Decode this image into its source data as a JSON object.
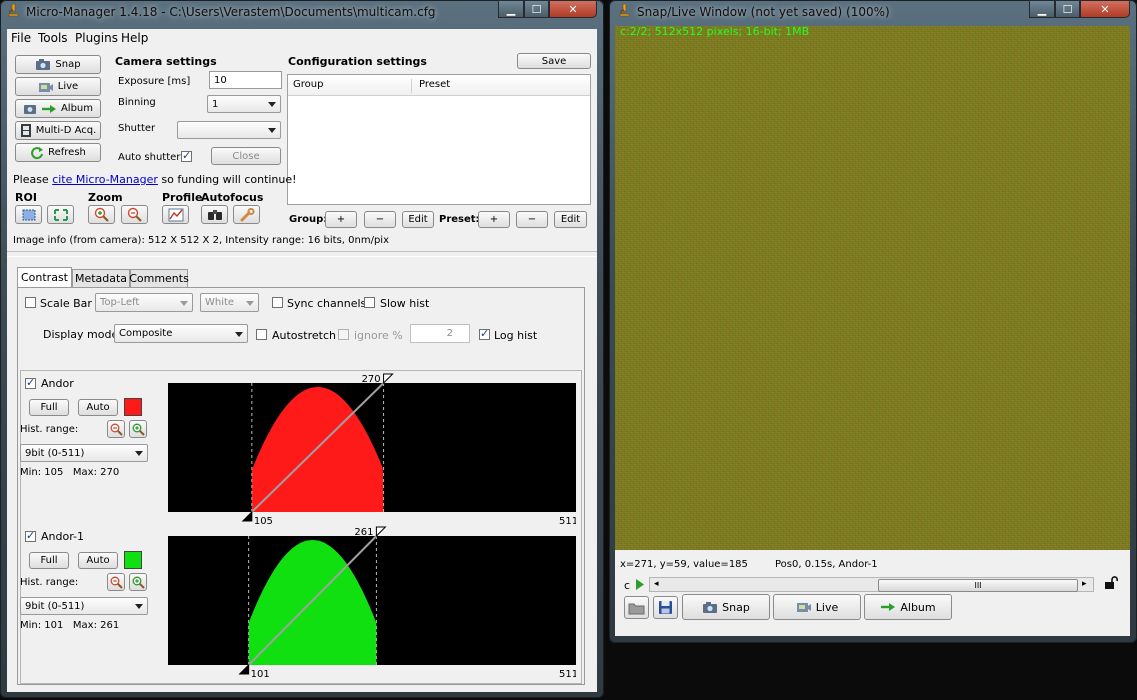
{
  "mm_window": {
    "title": "Micro-Manager 1.4.18 - C:\\Users\\Verastem\\Documents\\multicam.cfg",
    "menu": [
      "File",
      "Tools",
      "Plugins",
      "Help"
    ],
    "buttons": {
      "snap": "Snap",
      "live": "Live",
      "album": "Album",
      "multid": "Multi-D Acq.",
      "refresh": "Refresh"
    },
    "camera": {
      "heading": "Camera settings",
      "exposure_label": "Exposure [ms]",
      "exposure_value": "10",
      "binning_label": "Binning",
      "binning_value": "1",
      "shutter_label": "Shutter",
      "shutter_value": "",
      "auto_shutter_label": "Auto shutter",
      "close_label": "Close"
    },
    "config": {
      "heading": "Configuration settings",
      "save": "Save",
      "col_group": "Group",
      "col_preset": "Preset",
      "group_label": "Group:",
      "preset_label": "Preset:",
      "plus": "+",
      "minus": "−",
      "edit": "Edit"
    },
    "cite": {
      "pre": "Please",
      "link": "cite Micro-Manager",
      "post": "so funding will continue!"
    },
    "tool_headings": {
      "roi": "ROI",
      "zoom": "Zoom",
      "profile": "Profile",
      "autofocus": "Autofocus"
    },
    "image_info": "Image info (from camera): 512 X 512 X 2, Intensity range: 16 bits, 0nm/pix",
    "tabs": [
      "Contrast",
      "Metadata",
      "Comments"
    ],
    "contrast": {
      "scale_bar_label": "Scale Bar",
      "position_value": "Top-Left",
      "color_value": "White",
      "sync_channels": "Sync channels",
      "slow_hist": "Slow hist",
      "display_mode_label": "Display mode:",
      "display_mode_value": "Composite",
      "autostretch": "Autostretch",
      "ignore_label": "ignore %",
      "ignore_value": "2",
      "log_hist": "Log hist"
    },
    "channels": [
      {
        "name": "Andor",
        "color": "#ff1a1a",
        "full": "Full",
        "auto": "Auto",
        "hist_range_label": "Hist. range:",
        "bit_depth": "9bit (0-511)",
        "min_max": "Min: 105   Max: 270",
        "min": "105",
        "max": "270",
        "range_max": "511",
        "hist_range_min": 0,
        "hist_range_max": 511
      },
      {
        "name": "Andor-1",
        "color": "#10e010",
        "full": "Full",
        "auto": "Auto",
        "hist_range_label": "Hist. range:",
        "bit_depth": "9bit (0-511)",
        "min_max": "Min: 101   Max: 261",
        "min": "101",
        "max": "261",
        "range_max": "511",
        "hist_range_min": 0,
        "hist_range_max": 511
      }
    ]
  },
  "live_window": {
    "title": "Snap/Live Window (not yet saved) (100%)",
    "overlay": "c:2/2; 512x512 pixels; 16-bit; 1MB",
    "pixel_info": "x=271, y=59, value=185",
    "pos_info": "Pos0, 0.15s, Andor-1",
    "channel_label": "c",
    "scrollbar_grip": "III",
    "buttons": {
      "snap": "Snap",
      "live": "Live",
      "album": "Album"
    }
  },
  "colors": {
    "frame": "#3e4c56",
    "client": "#f0f0f0",
    "link": "#0000cc",
    "overlay_text": "#22ff22",
    "noise_base": "#7f8424",
    "arrow_green": "#2aa02a"
  },
  "icons": {
    "app": "microscope-icon",
    "camera": "camera-icon",
    "arrow": "arrow-right-icon",
    "film": "film-icon",
    "refresh": "refresh-icon",
    "roi": "roi-icon",
    "zoom_in": "zoom-in-icon",
    "zoom_out": "zoom-out-icon",
    "profile": "profile-icon",
    "autofocus": "binoculars-icon",
    "wrench": "wrench-icon",
    "folder": "folder-icon",
    "save": "save-disk-icon",
    "play": "play-icon",
    "lock": "lock-icon"
  }
}
